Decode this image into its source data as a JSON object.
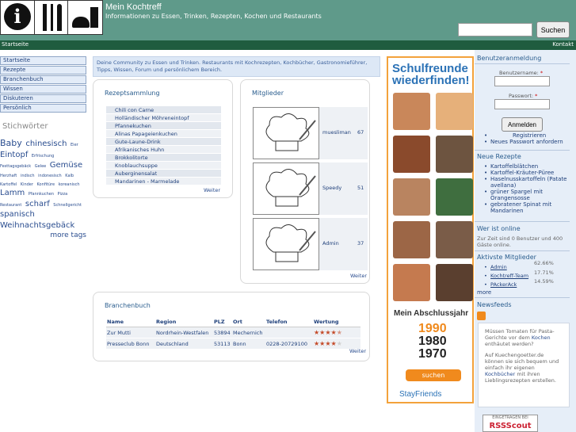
{
  "header": {
    "title": "Mein Kochtreff",
    "subtitle": "Informationen zu Essen, Trinken, Rezepten, Kochen und Restaurants",
    "search_button": "Suchen",
    "search_placeholder": ""
  },
  "topnav": {
    "left": "Startseite",
    "right": "Kontakt"
  },
  "sidebar": {
    "items": [
      {
        "label": "Startseite"
      },
      {
        "label": "Rezepte"
      },
      {
        "label": "Branchenbuch"
      },
      {
        "label": "Wissen"
      },
      {
        "label": "Diskuteren"
      },
      {
        "label": "Persönlich"
      }
    ],
    "tags_title": "Stichwörter",
    "tags": [
      {
        "text": "Baby",
        "size": 11
      },
      {
        "text": "chinesisch",
        "size": 10
      },
      {
        "text": "Eier",
        "size": 5
      },
      {
        "text": "Eintopf",
        "size": 10
      },
      {
        "text": "Erfrischung",
        "size": 5
      },
      {
        "text": "Festtagsgebäck",
        "size": 5
      },
      {
        "text": "Gelee",
        "size": 5
      },
      {
        "text": "Gemüse",
        "size": 10
      },
      {
        "text": "Herzhaft",
        "size": 5
      },
      {
        "text": "indisch",
        "size": 5
      },
      {
        "text": "indonesisch",
        "size": 5
      },
      {
        "text": "Kalb",
        "size": 5
      },
      {
        "text": "Kartoffel",
        "size": 5
      },
      {
        "text": "Kinder",
        "size": 5
      },
      {
        "text": "Konfitüre",
        "size": 5
      },
      {
        "text": "koreanisch",
        "size": 5
      },
      {
        "text": "Lamm",
        "size": 10
      },
      {
        "text": "Pfannkuchen",
        "size": 5
      },
      {
        "text": "Pizza",
        "size": 5
      },
      {
        "text": "Restaurant",
        "size": 5
      },
      {
        "text": "scharf",
        "size": 10
      },
      {
        "text": "Schnellgericht",
        "size": 5
      },
      {
        "text": "spanisch",
        "size": 10
      },
      {
        "text": "Weihnachtsgebäck",
        "size": 10
      }
    ],
    "more_tags": "more tags"
  },
  "intro": "Deine Community zu Essen und Trinken. Restaurants mit Kochrezepten, Kochbücher, Gastronomieführer, Tipps, Wissen, Forum und persönlichem Bereich.",
  "rezepte": {
    "title": "Rezeptsammlung",
    "items": [
      "Chili con Carne",
      "Holländischer Möhreneintopf",
      "Pfannekuchen",
      "Alinas Papageienkuchen",
      "Gute-Laune-Drink",
      "Afrikanisches Huhn",
      "Brokkolitorte",
      "Knoblauchsuppe",
      "Auberginensalat",
      "Mandarinen - Marmelade"
    ],
    "more": "Weiter"
  },
  "mitglieder": {
    "title": "Mitglieder",
    "members": [
      {
        "name": "muesliman",
        "score": "67"
      },
      {
        "name": "Speedy",
        "score": "51"
      },
      {
        "name": "Admin",
        "score": "37"
      }
    ],
    "more": "Weiter"
  },
  "branchen": {
    "title": "Branchenbuch",
    "headers": [
      "Name",
      "Region",
      "PLZ",
      "Ort",
      "Telefon",
      "Wertung"
    ],
    "rows": [
      {
        "name": "Zur Mutti",
        "region": "Nordrhein-Westfalen",
        "plz": "53894",
        "ort": "Mechernich",
        "telefon": "",
        "rating": 4.5
      },
      {
        "name": "Presseclub Bonn",
        "region": "Deutschland",
        "plz": "53113",
        "ort": "Bonn",
        "telefon": "0228-20729100",
        "rating": 4
      }
    ],
    "more": "Weiter"
  },
  "ad": {
    "title": "Schulfreunde wiederfinden!",
    "sub": "Mein Abschlussjahr",
    "years": [
      "1990",
      "1980",
      "1970"
    ],
    "button": "suchen",
    "brand": "StayFriends"
  },
  "right": {
    "login_title": "Benutzeranmeldung",
    "user_label": "Benutzername:",
    "pass_label": "Passwort:",
    "required": "*",
    "login_button": "Anmelden",
    "login_links": [
      "Registrieren",
      "Neues Passwort anfordern"
    ],
    "new_recipes_title": "Neue Rezepte",
    "new_recipes": [
      "Kartoffelblätchen",
      "Kartoffel-Kräuter-Püree",
      "Haselnusskartoffeln (Patate avellana)",
      "grüner Spargel mit Orangensosse",
      "gebratener Spinat mit Mandarinen"
    ],
    "online_title": "Wer ist online",
    "online_text": "Zur Zeit sind 0 Benutzer und 400 Gäste online.",
    "active_title": "Aktivste Mitglieder",
    "active": [
      {
        "name": "Admin",
        "pct": "62.66%"
      },
      {
        "name": "Kochtreff-Team",
        "pct": "17.71%"
      },
      {
        "name": "PAckerAck",
        "pct": "14.59%"
      }
    ],
    "active_more": "more",
    "feeds_title": "Newsfeeds",
    "feed_text_1": "Müssen Tomaten für Pasta-Gerichte vor dem",
    "feed_link_1": "Kochen",
    "feed_text_1b": "enthäutet werden?",
    "feed_text_2": "Auf Kuechengoetter.de können sie sich bequem und einfach ihr eigenen",
    "feed_link_2": "Kochbücher",
    "feed_text_2b": "mit ihren Lieblingsrezepten erstellen.",
    "rss_badge_top": "EINGETRAGEN BEI",
    "rss_badge": "RSSScout"
  }
}
